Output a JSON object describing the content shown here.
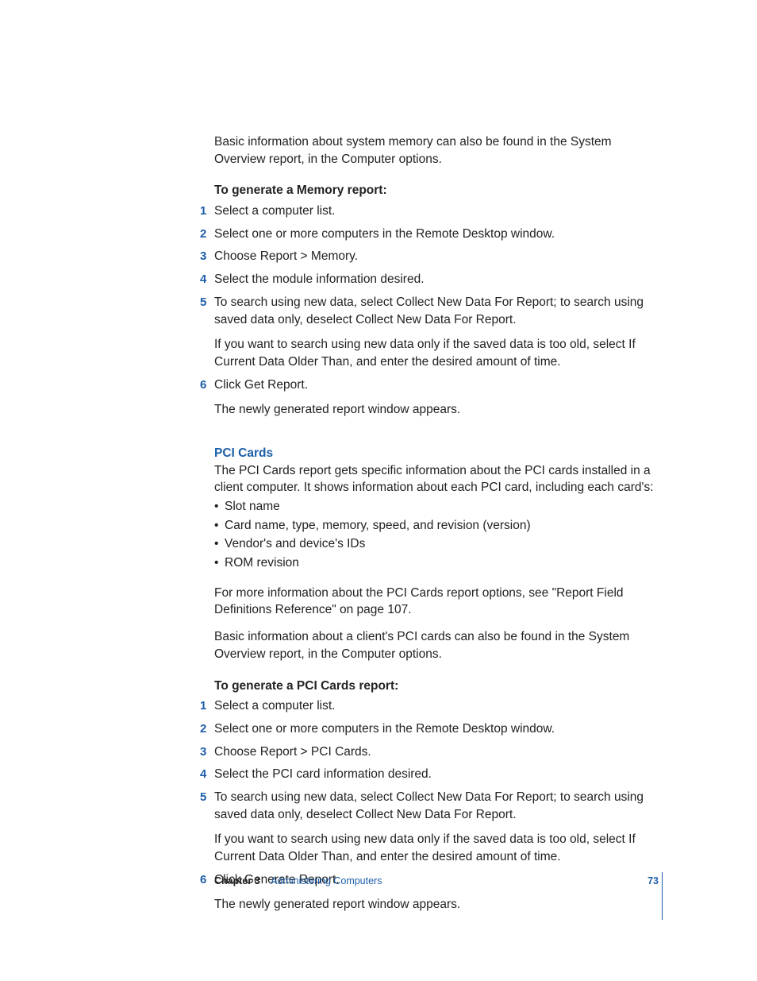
{
  "intro_memory": "Basic information about system memory can also be found in the System Overview report, in the Computer options.",
  "memory_heading": "To generate a Memory report:",
  "memory_steps": {
    "s1": "Select a computer list.",
    "s2": "Select one or more computers in the Remote Desktop window.",
    "s3": "Choose Report > Memory.",
    "s4": "Select the module information desired.",
    "s5a": "To search using new data, select Collect New Data For Report; to search using saved data only, deselect Collect New Data For Report.",
    "s5b": "If you want to search using new data only if the saved data is too old, select If Current Data Older Than, and enter the desired amount of time.",
    "s6a": "Click Get Report.",
    "s6b": "The newly generated report window appears."
  },
  "pci_title": "PCI Cards",
  "pci_intro": "The PCI Cards report gets specific information about the PCI cards installed in a client computer. It shows information about each PCI card, including each card's:",
  "pci_bullets": {
    "b1": "Slot name",
    "b2": "Card name, type, memory, speed, and revision (version)",
    "b3": "Vendor's and device's IDs",
    "b4": "ROM revision"
  },
  "pci_more": "For more information about the PCI Cards report options, see \"Report Field Definitions Reference\" on page 107.",
  "pci_basic": "Basic information about a client's PCI cards can also be found in the System Overview report, in the Computer options.",
  "pci_heading": "To generate a PCI Cards report:",
  "pci_steps": {
    "s1": "Select a computer list.",
    "s2": "Select one or more computers in the Remote Desktop window.",
    "s3": "Choose Report > PCI Cards.",
    "s4": "Select the PCI card information desired.",
    "s5a": "To search using new data, select Collect New Data For Report; to search using saved data only, deselect Collect New Data For Report.",
    "s5b": "If you want to search using new data only if the saved data is too old, select If Current Data Older Than, and enter the desired amount of time.",
    "s6a": "Click Generate Report.",
    "s6b": "The newly generated report window appears."
  },
  "footer": {
    "chapter": "Chapter 3",
    "title": "Administering Computers",
    "page": "73"
  }
}
